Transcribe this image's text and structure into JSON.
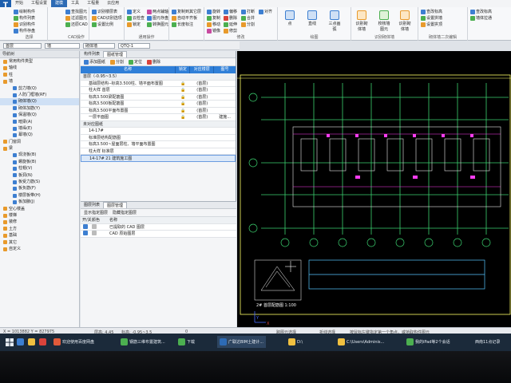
{
  "app": {
    "logo": "T"
  },
  "ribbon_tabs": [
    "开始",
    "工程设置",
    "建模",
    "工具",
    "工程量",
    "云应用"
  ],
  "ribbon": {
    "g1": {
      "items": [
        "绘制构件",
        "构件列表",
        "识别构件",
        "构件存盘"
      ],
      "label": "选择"
    },
    "g2": {
      "items": [
        "查找图元",
        "过滤图元",
        "还原CAD"
      ],
      "label": "CAD操作"
    },
    "g3": {
      "items": [
        "识别楼层表",
        "CAD识别选项",
        "设置比例"
      ]
    },
    "g4": {
      "items": [
        "定义",
        "云检查",
        "锁定",
        "两点辅轴",
        "图元存盘",
        "转换图元"
      ],
      "label": "通用操作"
    },
    "g5": {
      "items": [
        "复制到其它层",
        "自动平齐板",
        "长度标注",
        "图元存盘",
        "两点辅轴"
      ]
    },
    "g6": {
      "items": [
        "旋转",
        "复制",
        "移动",
        "镜像",
        "偏移",
        "删除",
        "延伸",
        "修剪",
        "打断",
        "合并",
        "分割",
        "对齐"
      ],
      "label": "修改"
    },
    "g7": {
      "items": [
        "点",
        "直线",
        "三点画弧"
      ],
      "label": "绘图"
    },
    "g8": {
      "items": [
        "识别砌体墙",
        "校核墙图元",
        "识别砌体墙"
      ],
      "label": "识别砌体墙"
    },
    "g9": {
      "items": [
        "查改标高",
        "设置拱墙",
        "设置拱顶"
      ],
      "label": "砌体墙二次编辑"
    },
    "g10": {
      "items": [
        "查改标高",
        "墙体拉通"
      ]
    }
  },
  "toolbar2": {
    "floor": "首层",
    "category": "墙",
    "type": "砌体墙",
    "element": "QTQ-1"
  },
  "left_panel": {
    "title": "导航树",
    "items": [
      {
        "label": "常用构件类型",
        "depth": 0,
        "color": "#e89a2c"
      },
      {
        "label": "轴线",
        "depth": 0,
        "color": "#e89a2c"
      },
      {
        "label": "柱",
        "depth": 0,
        "color": "#e89a2c"
      },
      {
        "label": "墙",
        "depth": 0,
        "color": "#e89a2c"
      },
      {
        "label": "剪力墙(Q)",
        "depth": 1,
        "color": "#3d7fd1"
      },
      {
        "label": "人防门框墙(RF)",
        "depth": 1,
        "color": "#3d7fd1"
      },
      {
        "label": "砌体墙(Q)",
        "depth": 1,
        "color": "#3d7fd1",
        "selected": true
      },
      {
        "label": "砌体加筋(Y)",
        "depth": 1,
        "color": "#3d7fd1"
      },
      {
        "label": "保温墙(Q)",
        "depth": 1,
        "color": "#3d7fd1"
      },
      {
        "label": "暗梁(A)",
        "depth": 1,
        "color": "#3d7fd1"
      },
      {
        "label": "墙垛(E)",
        "depth": 1,
        "color": "#3d7fd1"
      },
      {
        "label": "幕墙(Q)",
        "depth": 1,
        "color": "#3d7fd1"
      },
      {
        "label": "门窗洞",
        "depth": 0,
        "color": "#e89a2c"
      },
      {
        "label": "梁",
        "depth": 0,
        "color": "#e89a2c"
      },
      {
        "label": "现浇板(B)",
        "depth": 1,
        "color": "#3d7fd1"
      },
      {
        "label": "螺旋板(B)",
        "depth": 1,
        "color": "#3d7fd1"
      },
      {
        "label": "柱帽(V)",
        "depth": 1,
        "color": "#3d7fd1"
      },
      {
        "label": "板洞(N)",
        "depth": 1,
        "color": "#3d7fd1"
      },
      {
        "label": "板受力筋(S)",
        "depth": 1,
        "color": "#3d7fd1"
      },
      {
        "label": "板负筋(F)",
        "depth": 1,
        "color": "#3d7fd1"
      },
      {
        "label": "楼层板带(H)",
        "depth": 1,
        "color": "#3d7fd1"
      },
      {
        "label": "板加腋(J)",
        "depth": 1,
        "color": "#3d7fd1"
      },
      {
        "label": "空心楼盖",
        "depth": 0,
        "color": "#e89a2c"
      },
      {
        "label": "楼梯",
        "depth": 0,
        "color": "#e89a2c"
      },
      {
        "label": "装修",
        "depth": 0,
        "color": "#e89a2c"
      },
      {
        "label": "土方",
        "depth": 0,
        "color": "#e89a2c"
      },
      {
        "label": "基础",
        "depth": 0,
        "color": "#e89a2c"
      },
      {
        "label": "其它",
        "depth": 0,
        "color": "#e89a2c"
      },
      {
        "label": "自定义",
        "depth": 0,
        "color": "#e89a2c"
      }
    ]
  },
  "mid_panel": {
    "tabs": [
      "构件列表",
      "图纸管理"
    ],
    "tools": [
      "添加图纸",
      "分割",
      "定位",
      "删除"
    ],
    "columns": [
      "名称",
      "锁定",
      "对应楼层",
      "图号"
    ],
    "rows": [
      {
        "name": "首层（-0.95~3.5）",
        "lock": "",
        "floor": "",
        "no": "",
        "group": true
      },
      {
        "name": "基础层结构--标高3.500柱、墙平面布置图",
        "lock": "🔒",
        "floor": "(首层)",
        "no": ""
      },
      {
        "name": "柱大样 首层",
        "lock": "🔒",
        "floor": "(首层)",
        "no": ""
      },
      {
        "name": "标高3.500梁配筋图",
        "lock": "🔒",
        "floor": "(首层)",
        "no": ""
      },
      {
        "name": "标高3.500板配筋图",
        "lock": "🔒",
        "floor": "(首层)",
        "no": ""
      },
      {
        "name": "标高3.500平面布置图",
        "lock": "🔒",
        "floor": "(首层)",
        "no": ""
      },
      {
        "name": "一层平面图",
        "lock": "🔒",
        "floor": "(首层)",
        "no": "建施..."
      },
      {
        "name": "未对应图纸",
        "lock": "",
        "floor": "",
        "no": "",
        "group": true
      },
      {
        "name": "14-17#",
        "lock": "",
        "floor": "",
        "no": ""
      },
      {
        "name": "标准层结构配筋图",
        "lock": "",
        "floor": "",
        "no": ""
      },
      {
        "name": "标高3.500~屋面层柱、墙平面布置图",
        "lock": "",
        "floor": "",
        "no": ""
      },
      {
        "name": "柱大样 标准层",
        "lock": "",
        "floor": "",
        "no": ""
      },
      {
        "name": "14-17# 21 建筑施工图",
        "lock": "",
        "floor": "",
        "no": "",
        "highlight": true
      }
    ],
    "lower_tabs": [
      "图层列表",
      "图层管理"
    ],
    "lower_tools": [
      "显示指定图层",
      "隐藏指定图层"
    ],
    "lower_cols": [
      "开/关",
      "颜色",
      "名称"
    ],
    "lower_rows": [
      {
        "name": "已提取的 CAD 图层"
      },
      {
        "name": "CAD 原始图层"
      }
    ]
  },
  "cad": {
    "title_tag": "2# 首层配筋图 1:100"
  },
  "status": {
    "coords": "X = 1013882 Y = 827975",
    "floor_h": "层高: 4.45",
    "elev": "标高: -0.95~3.5",
    "zero": "0",
    "hint1": "跨图元选择",
    "hint2": "折线选择",
    "hint3": "按鼠标左键指定第一个角点，或拾取构件图元"
  },
  "taskbar": {
    "items": [
      {
        "label": "欢迎使用百度网盘",
        "color": "#e05a3a"
      },
      {
        "label": "钢筋三维布置建筑...",
        "color": "#4caf50"
      },
      {
        "label": "下载",
        "color": "#4caf50"
      },
      {
        "label": "广联达BIM土建计...",
        "color": "#2d6bb5"
      },
      {
        "label": "D:\\",
        "color": "#f0c040"
      },
      {
        "label": "C:\\Users\\Adminis...",
        "color": "#f0c040"
      },
      {
        "label": "我的iPad等2个会话",
        "color": "#4caf50"
      }
    ],
    "tray": "西南11点记录"
  }
}
